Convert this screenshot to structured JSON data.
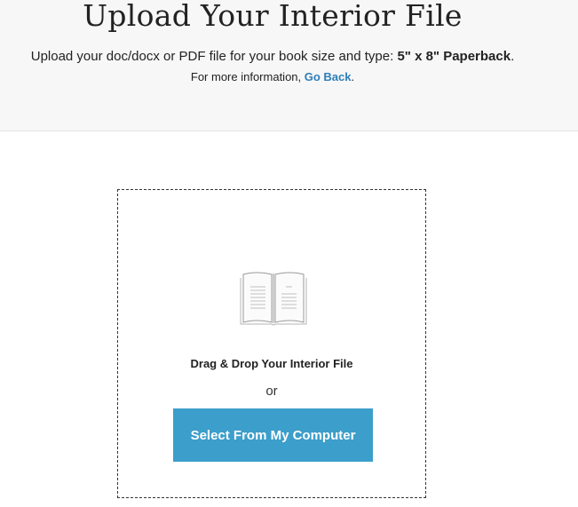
{
  "header": {
    "title": "Upload Your Interior File",
    "subtitle_prefix": "Upload your doc/docx or PDF file for your book size and type: ",
    "subtitle_book_type": "5\" x 8\" Paperback",
    "subtitle_suffix": ".",
    "info_prefix": "For more information, ",
    "info_link": "Go Back",
    "info_suffix": "."
  },
  "dropzone": {
    "icon": "open-book-icon",
    "drop_label": "Drag & Drop Your Interior File",
    "or_label": "or",
    "button_label": "Select From My Computer"
  },
  "colors": {
    "accent": "#3c9ecb",
    "link": "#2e7fb8",
    "header_bg": "#f7f7f7"
  }
}
